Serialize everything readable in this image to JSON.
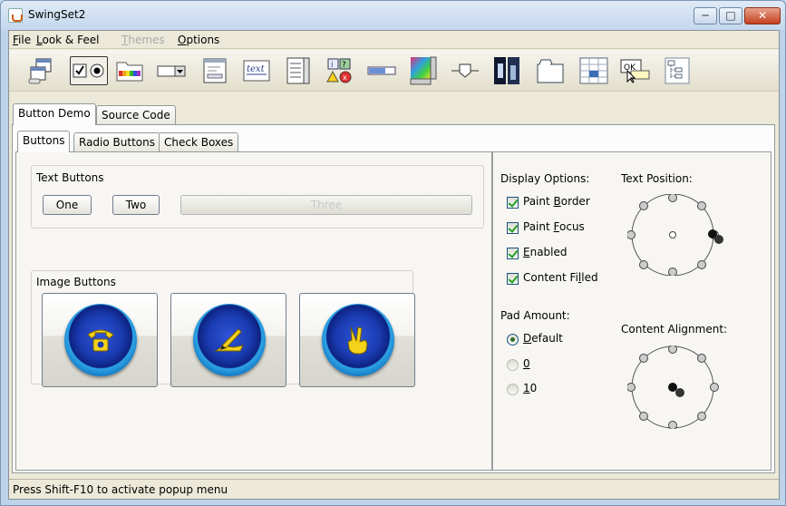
{
  "window": {
    "title": "SwingSet2",
    "controls": {
      "minimize": "─",
      "maximize": "□",
      "close": "✕"
    }
  },
  "menubar": [
    {
      "label": "File",
      "mnemonic": "F",
      "rest": "ile",
      "enabled": true
    },
    {
      "label": "Look & Feel",
      "mnemonic": "L",
      "rest": "ook & Feel",
      "enabled": true
    },
    {
      "label": "Themes",
      "mnemonic": "T",
      "rest": "hemes",
      "enabled": false
    },
    {
      "label": "Options",
      "mnemonic": "O",
      "rest": "ptions",
      "enabled": true
    }
  ],
  "toolbar_icons": [
    "internal-frame-icon",
    "button-demo-icon",
    "color-chooser-icon",
    "combobox-icon",
    "file-chooser-icon",
    "html-text-icon",
    "list-icon",
    "option-pane-icon",
    "progress-bar-icon",
    "scroll-pane-icon",
    "slider-icon",
    "split-pane-icon",
    "tabbed-pane-icon",
    "table-icon",
    "tooltip-icon",
    "tree-icon"
  ],
  "toolbar_tooltip_text": {
    "text": "text",
    "ok": "OK"
  },
  "demo_tabs": [
    "Button Demo",
    "Source Code"
  ],
  "inner_tabs": [
    "Buttons",
    "Radio Buttons",
    "Check Boxes"
  ],
  "text_buttons": {
    "title": "Text Buttons",
    "one": "One",
    "two": "Two",
    "three": "Three"
  },
  "image_buttons": {
    "title": "Image Buttons",
    "items": [
      "phone-icon",
      "write-icon",
      "peace-icon"
    ]
  },
  "display_options": {
    "title": "Display Options:",
    "items": [
      {
        "pre": "Paint ",
        "mnemonic": "B",
        "post": "order",
        "checked": true
      },
      {
        "pre": "Paint ",
        "mnemonic": "F",
        "post": "ocus",
        "checked": true
      },
      {
        "pre": "",
        "mnemonic": "E",
        "post": "nabled",
        "checked": true
      },
      {
        "pre": "Content Fi",
        "mnemonic": "l",
        "post": "led",
        "checked": true
      }
    ]
  },
  "pad_amount": {
    "title": "Pad Amount:",
    "options": [
      {
        "mnemonic": "D",
        "post": "efault",
        "selected": true
      },
      {
        "mnemonic": "0",
        "post": "",
        "selected": false
      },
      {
        "mnemonic": "1",
        "post": "0",
        "selected": false
      }
    ]
  },
  "text_position": {
    "title": "Text Position:",
    "selected": "right"
  },
  "content_alignment": {
    "title": "Content Alignment:",
    "selected": "center"
  },
  "statusbar": {
    "text": "Press Shift-F10 to activate popup menu"
  }
}
